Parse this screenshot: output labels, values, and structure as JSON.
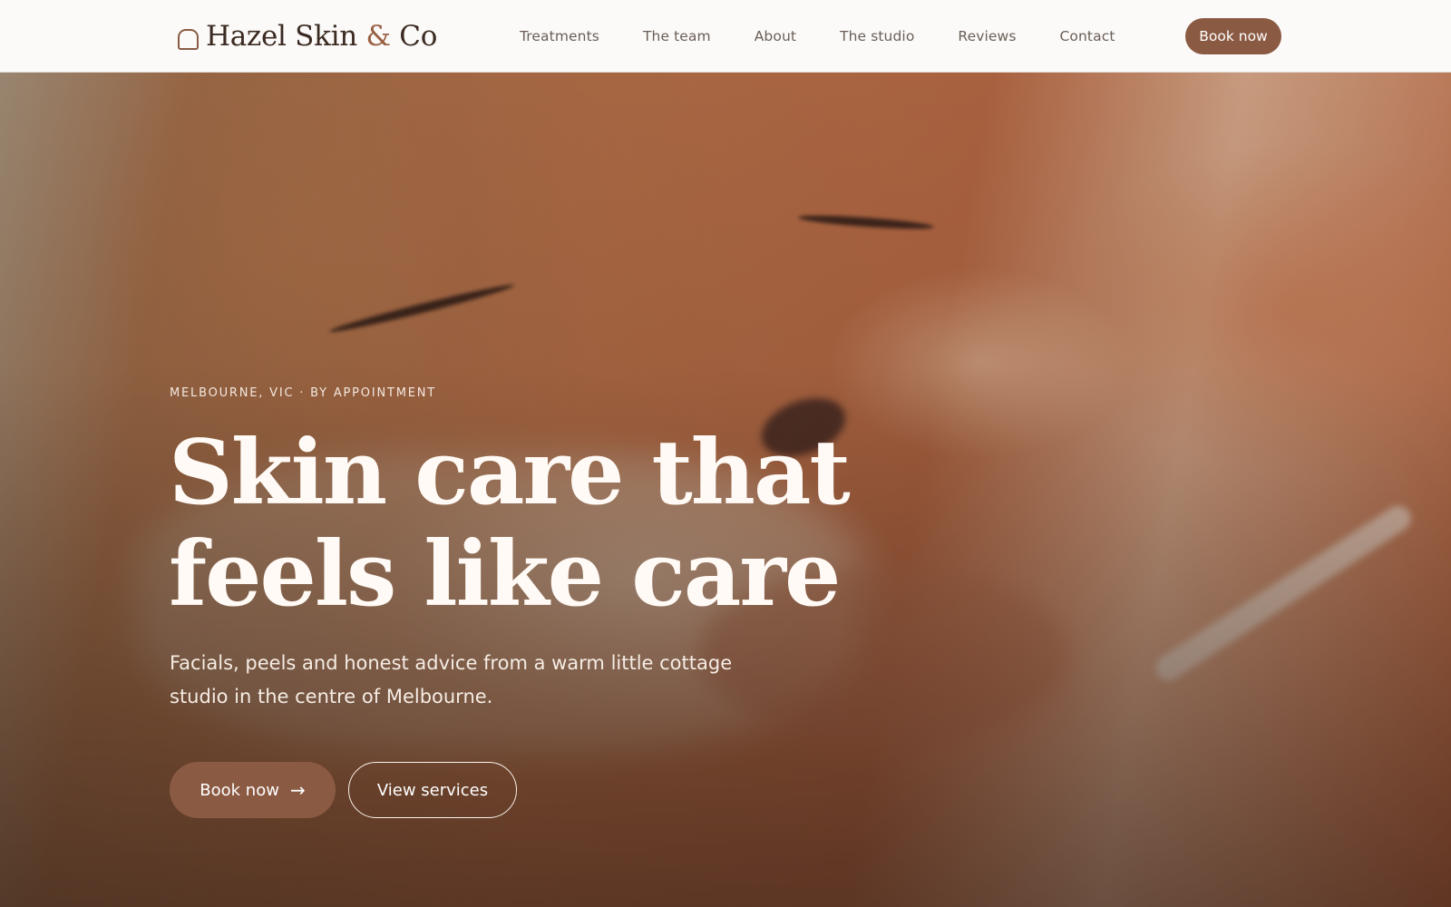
{
  "brand": {
    "name_part1": "Hazel Skin",
    "ampersand": "&",
    "name_part2": "Co",
    "icon": "arch-icon"
  },
  "nav": {
    "items": [
      "Treatments",
      "The team",
      "About",
      "The studio",
      "Reviews",
      "Contact"
    ]
  },
  "header": {
    "cta_label": "Book now"
  },
  "hero": {
    "eyebrow": "MELBOURNE, VIC · BY APPOINTMENT",
    "headline_line1": "Skin care that",
    "headline_line2": "feels like care",
    "subcopy": "Facials, peels and honest advice from a warm little cottage studio in the centre of Melbourne.",
    "primary_cta": "Book now",
    "primary_cta_icon": "arrow-right-icon",
    "secondary_cta": "View services"
  },
  "colors": {
    "accent": "#8b5a43",
    "header_bg": "#fbfaf8",
    "text_dark": "#3b2a22"
  }
}
